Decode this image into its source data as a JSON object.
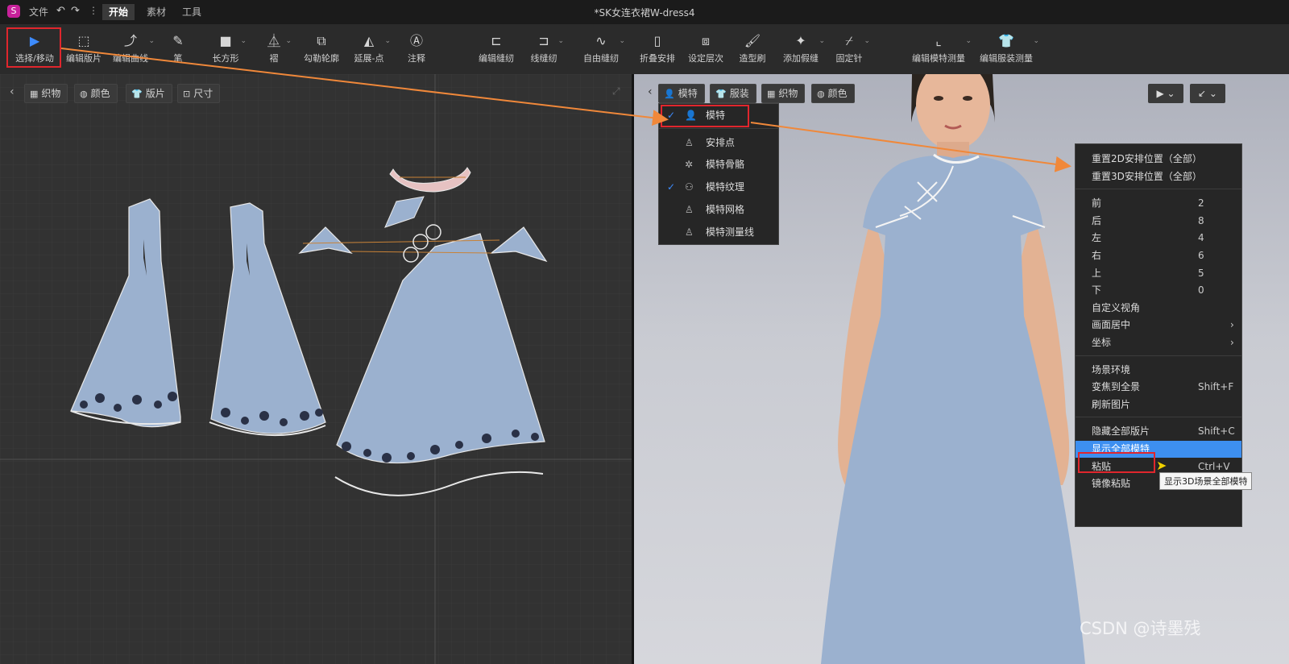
{
  "titlebar": {
    "doc_title": "*SK女连衣裙W-dress4",
    "menus": [
      "文件",
      "开始",
      "素材",
      "工具"
    ],
    "active_menu": "开始"
  },
  "toolbar": {
    "tools": [
      "选择/移动",
      "编辑版片",
      "编辑曲线",
      "笔",
      "长方形",
      "褶",
      "勾勒轮廓",
      "延展-点",
      "注释",
      "编辑缝纫",
      "线缝纫",
      "自由缝纫",
      "折叠安排",
      "设定层次",
      "造型刷",
      "添加假缝",
      "固定针",
      "编辑模特测量",
      "编辑服装测量"
    ]
  },
  "pane2d": {
    "tabs": [
      "织物",
      "颜色",
      "版片",
      "尺寸"
    ]
  },
  "pane3d": {
    "tabs": [
      "模特",
      "服装",
      "织物",
      "颜色"
    ],
    "avatar_menu": {
      "header": "模特",
      "items": [
        "安排点",
        "模特骨骼",
        "模特纹理",
        "模特网格",
        "模特测量线"
      ],
      "checked": [
        "模特",
        "模特纹理"
      ]
    },
    "context_menu": {
      "groups": [
        [
          {
            "label": "重置2D安排位置（全部）",
            "key": ""
          },
          {
            "label": "重置3D安排位置（全部）",
            "key": ""
          }
        ],
        [
          {
            "label": "前",
            "key": "2"
          },
          {
            "label": "后",
            "key": "8"
          },
          {
            "label": "左",
            "key": "4"
          },
          {
            "label": "右",
            "key": "6"
          },
          {
            "label": "上",
            "key": "5"
          },
          {
            "label": "下",
            "key": "0"
          },
          {
            "label": "自定义视角",
            "key": ""
          },
          {
            "label": "画面居中",
            "key": "›"
          },
          {
            "label": "坐标",
            "key": "›"
          }
        ],
        [
          {
            "label": "场景环境",
            "key": ""
          },
          {
            "label": "变焦到全景",
            "key": "Shift+F"
          },
          {
            "label": "刷新图片",
            "key": ""
          }
        ],
        [
          {
            "label": "隐藏全部版片",
            "key": "Shift+C"
          },
          {
            "label": "显示全部模特",
            "key": ""
          },
          {
            "label": "粘贴",
            "key": "Ctrl+V"
          },
          {
            "label": "镜像粘贴",
            "key": "Ctrl+R"
          }
        ]
      ],
      "highlighted": "显示全部模特",
      "tooltip": "显示3D场景全部模特"
    }
  },
  "watermark": "CSDN @诗墨残",
  "colors": {
    "accent": "#3d8bfd",
    "highlight_row": "#3d8ff0",
    "callout_red": "#e0262d",
    "arrow_orange": "#f0883a",
    "fabric": "#9bb1cf"
  }
}
